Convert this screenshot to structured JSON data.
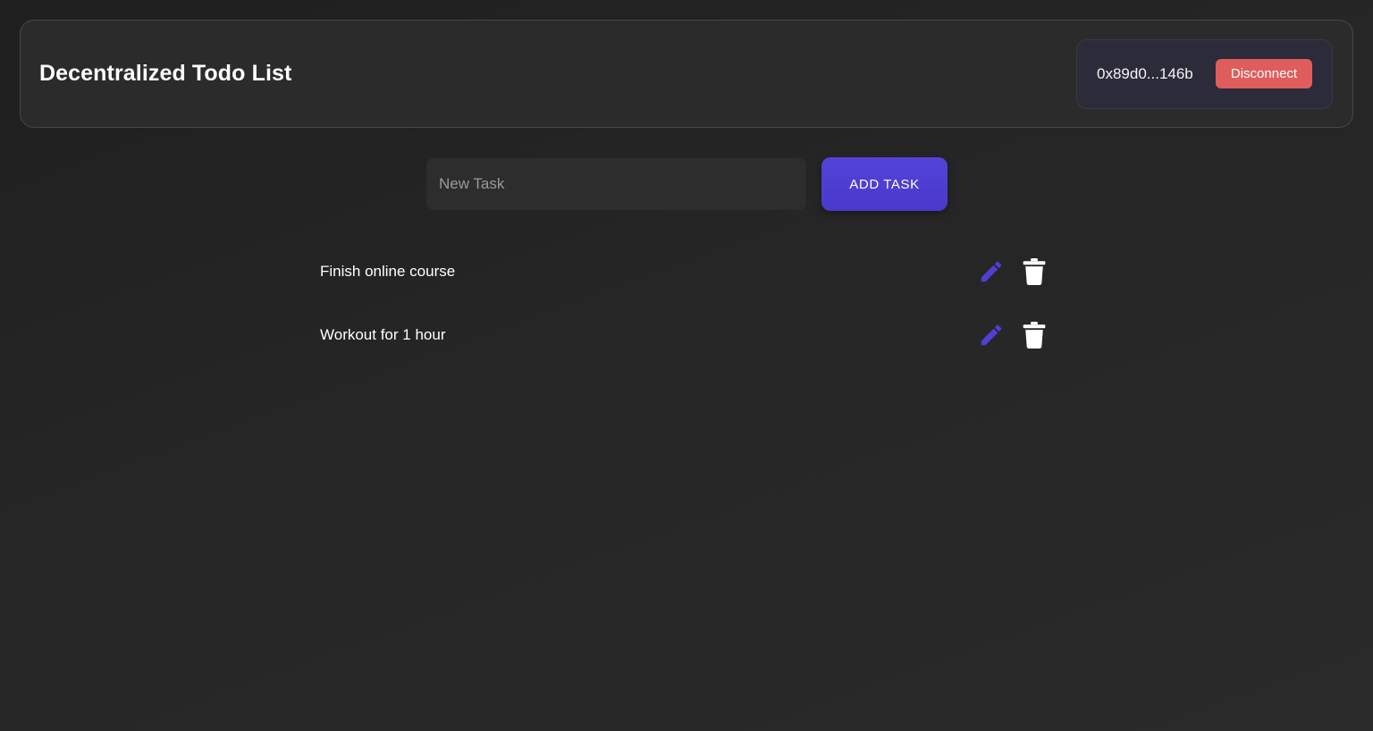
{
  "header": {
    "title": "Decentralized Todo List",
    "wallet_address": "0x89d0...146b",
    "disconnect_label": "Disconnect"
  },
  "new_task": {
    "placeholder": "New Task",
    "value": "",
    "add_label": "ADD TASK"
  },
  "tasks": [
    {
      "text": "Finish online course",
      "edit_icon": "edit-icon",
      "delete_icon": "trash-icon"
    },
    {
      "text": "Workout for 1 hour",
      "edit_icon": "edit-icon",
      "delete_icon": "trash-icon"
    }
  ],
  "colors": {
    "accent": "#4f3fd4",
    "danger": "#e05d5d",
    "background": "#232323",
    "panel": "#2b2b2b"
  }
}
